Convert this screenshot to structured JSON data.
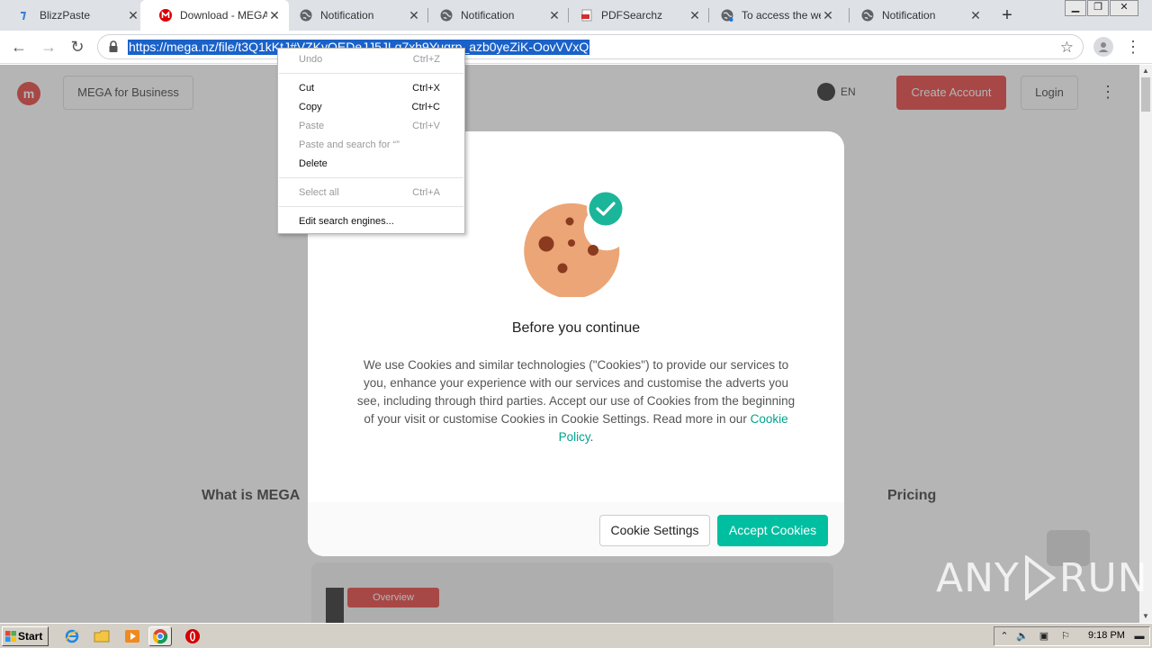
{
  "browser": {
    "tabs": [
      {
        "title": "BlizzPaste",
        "icon": "blizzpaste-icon",
        "active": false
      },
      {
        "title": "Download - MEGA",
        "icon": "mega-icon",
        "active": true
      },
      {
        "title": "Notification",
        "icon": "globe-icon",
        "active": false
      },
      {
        "title": "Notification",
        "icon": "globe-icon",
        "active": false
      },
      {
        "title": "PDFSearchz",
        "icon": "pdf-icon",
        "active": false
      },
      {
        "title": "To access the web",
        "icon": "globe-icon",
        "active": false
      },
      {
        "title": "Notification",
        "icon": "globe-icon",
        "active": false
      }
    ],
    "new_tab_label": "+",
    "url": "https://mega.nz/file/t3Q1kKtJ#VZKyQEDeJJ5JLq7xh9Yuqrp_azb0yeZiK-OovVVxQ"
  },
  "context_menu": {
    "items": [
      {
        "label": "Undo",
        "shortcut": "Ctrl+Z",
        "enabled": false
      },
      {
        "label": "Cut",
        "shortcut": "Ctrl+X",
        "enabled": true
      },
      {
        "label": "Copy",
        "shortcut": "Ctrl+C",
        "enabled": true
      },
      {
        "label": "Paste",
        "shortcut": "Ctrl+V",
        "enabled": false
      },
      {
        "label": "Paste and search for “”",
        "shortcut": "",
        "enabled": false
      },
      {
        "label": "Delete",
        "shortcut": "",
        "enabled": true
      },
      {
        "label": "Select all",
        "shortcut": "Ctrl+A",
        "enabled": false
      },
      {
        "label": "Edit search engines...",
        "shortcut": "",
        "enabled": true
      }
    ]
  },
  "mega_page": {
    "logo_text": "m",
    "business_label": "MEGA for Business",
    "language": "EN",
    "create_account_label": "Create Account",
    "login_label": "Login",
    "section_left": "What is MEGA",
    "section_right": "Pricing",
    "preview_label": "Overview"
  },
  "cookie_dialog": {
    "title": "Before you continue",
    "body": "We use Cookies and similar technologies (\"Cookies\") to provide our services to you, enhance your experience with our services and customise the adverts you see, including through third parties. Accept our use of Cookies from the beginning of your visit or customise Cookies in Cookie Settings. Read more in our",
    "link_text": "Cookie Policy",
    "body_end": ".",
    "settings_label": "Cookie Settings",
    "accept_label": "Accept Cookies",
    "accent_color": "#00bfa0"
  },
  "watermark": {
    "left": "ANY",
    "right": "RUN"
  },
  "taskbar": {
    "start_label": "Start",
    "clock": "9:18 PM"
  }
}
